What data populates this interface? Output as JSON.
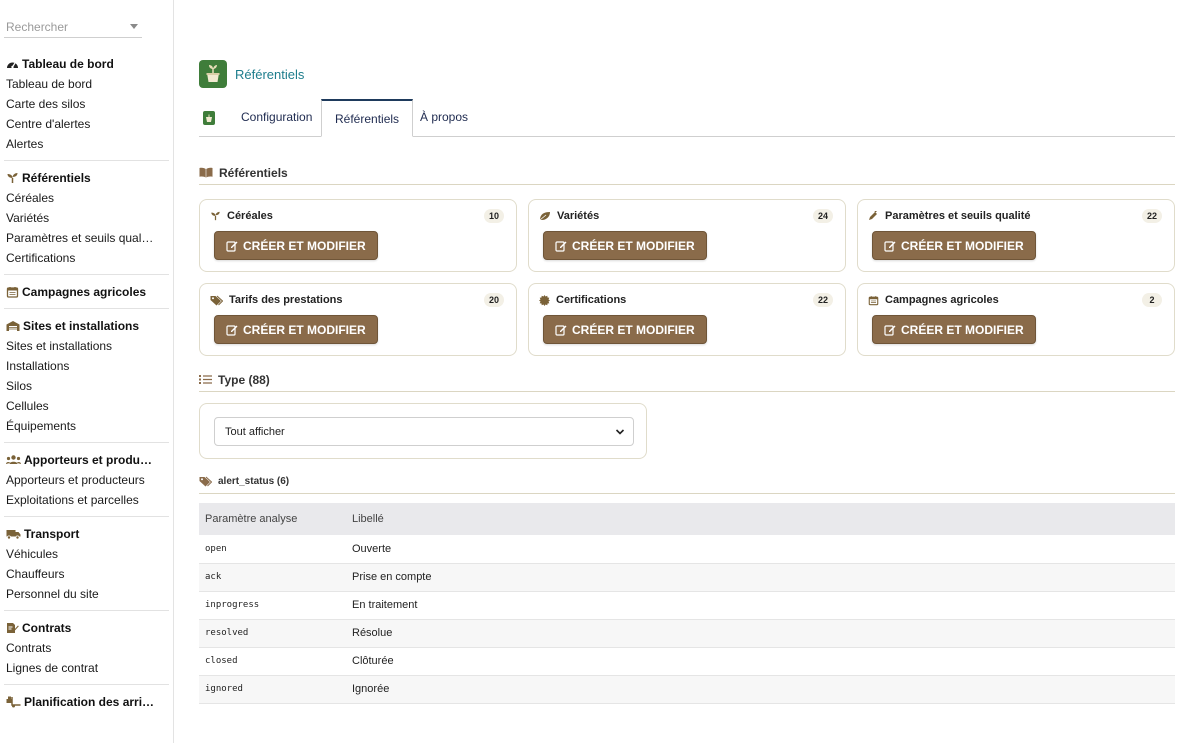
{
  "search": {
    "placeholder": "Rechercher"
  },
  "sidebar": {
    "groups": [
      {
        "title": "Tableau de bord",
        "items": [
          "Tableau de bord",
          "Carte des silos",
          "Centre d'alertes",
          "Alertes"
        ]
      },
      {
        "title": "Référentiels",
        "items": [
          "Céréales",
          "Variétés",
          "Paramètres et seuils qual…",
          "Certifications"
        ]
      },
      {
        "title": "Campagnes agricoles",
        "items": []
      },
      {
        "title": "Sites et installations",
        "items": [
          "Sites et installations",
          "Installations",
          "Silos",
          "Cellules",
          "Équipements"
        ]
      },
      {
        "title": "Apporteurs et produ…",
        "items": [
          "Apporteurs et producteurs",
          "Exploitations et parcelles"
        ]
      },
      {
        "title": "Transport",
        "items": [
          "Véhicules",
          "Chauffeurs",
          "Personnel du site"
        ]
      },
      {
        "title": "Contrats",
        "items": [
          "Contrats",
          "Lignes de contrat"
        ]
      },
      {
        "title": "Planification des arri…",
        "items": []
      }
    ]
  },
  "app": {
    "name": "Référentiels"
  },
  "tabs": [
    {
      "label": "Configuration"
    },
    {
      "label": "Référentiels"
    },
    {
      "label": "À propos"
    }
  ],
  "referentiels": {
    "title": "Référentiels",
    "button_label": "CRÉER ET MODIFIER",
    "cards": [
      {
        "title": "Céréales",
        "count": "10"
      },
      {
        "title": "Variétés",
        "count": "24"
      },
      {
        "title": "Paramètres et seuils qualité",
        "count": "22"
      },
      {
        "title": "Tarifs des prestations",
        "count": "20"
      },
      {
        "title": "Certifications",
        "count": "22"
      },
      {
        "title": "Campagnes agricoles",
        "count": "2"
      }
    ]
  },
  "type_section": {
    "title": "Type (88)",
    "selected": "Tout afficher"
  },
  "alert_status": {
    "title": "alert_status (6)",
    "columns": [
      "Paramètre analyse",
      "Libellé"
    ],
    "rows": [
      {
        "code": "open",
        "label": "Ouverte"
      },
      {
        "code": "ack",
        "label": "Prise en compte"
      },
      {
        "code": "inprogress",
        "label": "En traitement"
      },
      {
        "code": "resolved",
        "label": "Résolue"
      },
      {
        "code": "closed",
        "label": "Clôturée"
      },
      {
        "code": "ignored",
        "label": "Ignorée"
      }
    ]
  },
  "colors": {
    "accent": "#8a6b4a",
    "brand_green": "#3f7d3a",
    "link": "#1d7d8c"
  }
}
